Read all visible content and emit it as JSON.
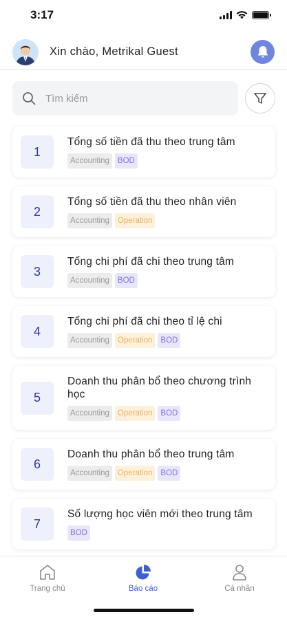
{
  "status_bar": {
    "time": "3:17"
  },
  "header": {
    "greeting": "Xin chào, Metrikal Guest"
  },
  "search": {
    "placeholder": "Tìm kiếm"
  },
  "reports": [
    {
      "number": "1",
      "title": "Tổng số tiền đã thu theo trung tâm",
      "tags": [
        "Accounting",
        "BOD"
      ]
    },
    {
      "number": "2",
      "title": "Tổng số tiền đã thu theo nhân viên",
      "tags": [
        "Accounting",
        "Operation"
      ]
    },
    {
      "number": "3",
      "title": "Tổng chi phí đã chi theo trung tâm",
      "tags": [
        "Accounting",
        "BOD"
      ]
    },
    {
      "number": "4",
      "title": "Tổng chi phí đã chi theo tỉ lệ chi",
      "tags": [
        "Accounting",
        "Operation",
        "BOD"
      ]
    },
    {
      "number": "5",
      "title": "Doanh thu phân bổ theo chương trình học",
      "tags": [
        "Accounting",
        "Operation",
        "BOD"
      ]
    },
    {
      "number": "6",
      "title": "Doanh thu phân bổ theo trung tâm",
      "tags": [
        "Accounting",
        "Operation",
        "BOD"
      ]
    },
    {
      "number": "7",
      "title": "Số lượng học viên mới theo trung tâm",
      "tags": [
        "BOD"
      ]
    }
  ],
  "bottom_nav": {
    "home": "Trang chủ",
    "reports": "Báo cáo",
    "profile": "Cá nhân",
    "active": "reports"
  },
  "colors": {
    "accent": "#3f5fd0",
    "bell_bg": "#6e86de",
    "number_bg": "#eef0fb",
    "tag_accounting": "#9a9a9a",
    "tag_operation": "#e9b45c",
    "tag_bod": "#7d72e0"
  },
  "icons": {
    "search": "search-icon",
    "filter": "filter-icon",
    "bell": "bell-icon",
    "home": "home-icon",
    "reports": "pie-chart-icon",
    "profile": "user-icon"
  }
}
